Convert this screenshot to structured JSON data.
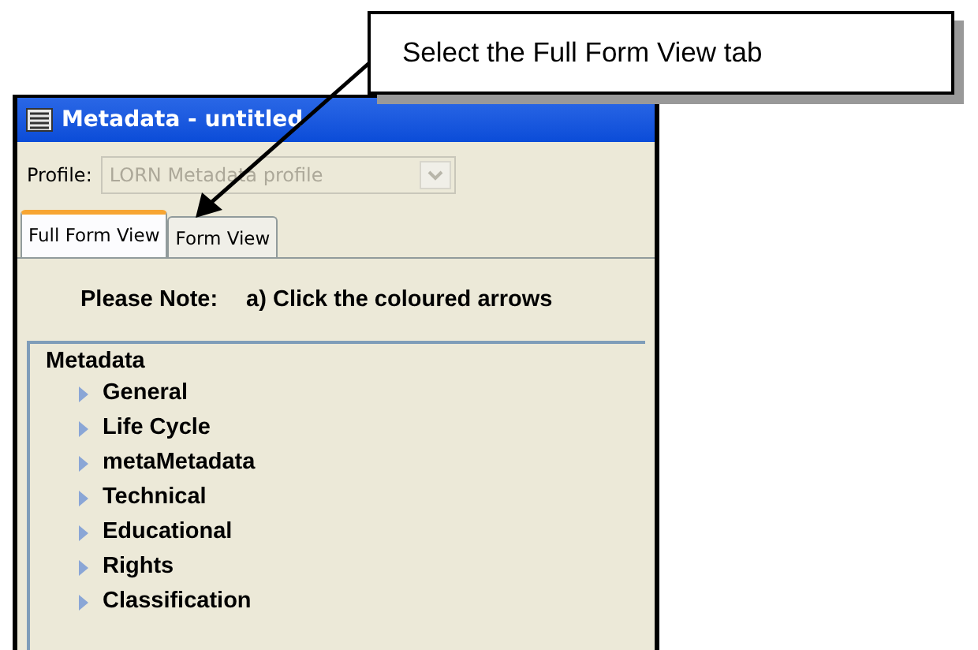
{
  "callout": {
    "text": "Select the Full Form View tab"
  },
  "window": {
    "title": "Metadata - untitled"
  },
  "profile": {
    "label": "Profile:",
    "value": "LORN Metadata profile",
    "disabled": true
  },
  "tabs": [
    {
      "label": "Full Form View",
      "selected": true
    },
    {
      "label": "Form View",
      "selected": false
    }
  ],
  "note": {
    "label": "Please Note:",
    "text": "a) Click the coloured arrows"
  },
  "tree": {
    "label": "Metadata",
    "children": [
      {
        "label": "General",
        "expanded": false
      },
      {
        "label": "Life Cycle",
        "expanded": false
      },
      {
        "label": "metaMetadata",
        "expanded": false
      },
      {
        "label": "Technical",
        "expanded": false
      },
      {
        "label": "Educational",
        "expanded": false
      },
      {
        "label": "Rights",
        "expanded": false
      },
      {
        "label": "Classification",
        "expanded": false
      }
    ]
  }
}
